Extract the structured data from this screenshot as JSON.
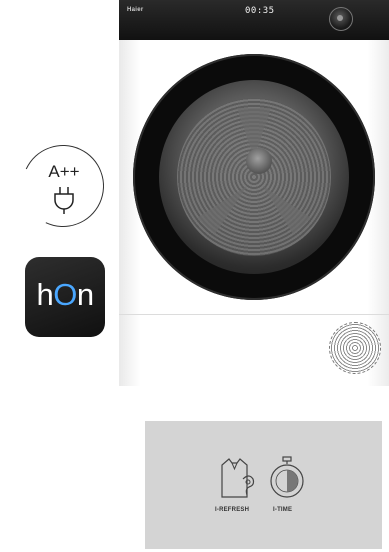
{
  "dryer": {
    "brand": "Haier",
    "display_time": "00:35"
  },
  "energy_badge": {
    "rating": "A++"
  },
  "app_tile": {
    "logo_h": "h",
    "logo_o": "O",
    "logo_n": "n"
  },
  "features": [
    {
      "label": "I-REFRESH",
      "icon": "shirt-icon"
    },
    {
      "label": "I-TIME",
      "icon": "stopwatch-icon"
    }
  ],
  "colors": {
    "app_accent": "#4aa7ff",
    "panel_bg": "#d4d4d4",
    "dryer_door": "#0b0b0b"
  }
}
